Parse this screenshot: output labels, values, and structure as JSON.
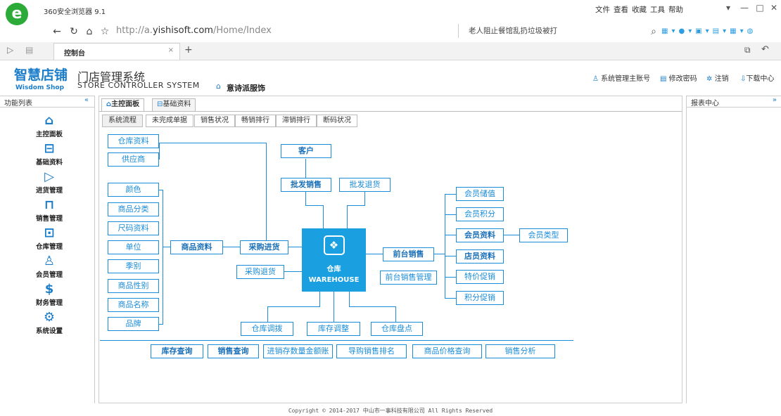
{
  "browser": {
    "title": "360安全浏览器 9.1",
    "menus": [
      "文件",
      "查看",
      "收藏",
      "工具",
      "帮助"
    ],
    "url_prefix": "http://a.",
    "url_domain": "yishisoft.com",
    "url_path": "/Home/Index",
    "news": "老人阻止餐馆乱扔垃圾被打",
    "tab_label": "控制台"
  },
  "header": {
    "brand_cn": "智慧店铺",
    "brand_en": "Wisdom Shop",
    "system_cn": "门店管理系统",
    "system_en": "STORE CONTROLLER SYSTEM",
    "shop_name": "意诗派服饰",
    "links": [
      "系统管理主账号",
      "修改密码",
      "注销",
      "下载中心"
    ]
  },
  "left": {
    "title": "功能列表",
    "items": [
      "主控面板",
      "基础资料",
      "进货管理",
      "销售管理",
      "仓库管理",
      "会员管理",
      "财务管理",
      "系统设置"
    ]
  },
  "right": {
    "title": "报表中心"
  },
  "main_tabs": [
    "主控面板",
    "基础资料"
  ],
  "sub_tabs": [
    "系统流程",
    "未完成单据",
    "销售状况",
    "畅销排行",
    "滞销排行",
    "断码状况"
  ],
  "diagram": {
    "top_left": [
      "仓库资料",
      "供应商"
    ],
    "goods_attrs": [
      "颜色",
      "商品分类",
      "尺码资料",
      "单位",
      "季别",
      "商品性别",
      "商品名称",
      "品牌"
    ],
    "goods_info": "商品资料",
    "purchase": "采购进货",
    "purchase_return": "采购退货",
    "customer": "客户",
    "wholesale": "批发销售",
    "wholesale_return": "批发退货",
    "warehouse_cn": "仓库",
    "warehouse_en": "WAREHOUSE",
    "front_sales": "前台销售",
    "front_sales_mgmt": "前台销售管理",
    "member_items": [
      "会员储值",
      "会员积分",
      "会员资料",
      "店员资料",
      "特价促销",
      "积分促销"
    ],
    "member_type": "会员类型",
    "bottom_ops": [
      "仓库调拨",
      "库存调整",
      "仓库盘点"
    ],
    "queries": [
      "库存查询",
      "销售查询",
      "进销存数量金额账",
      "导购销售排名",
      "商品价格查询",
      "销售分析"
    ]
  },
  "footer": "Copyright © 2014-2017 中山市一事科技有限公司 All Rights Reserved"
}
